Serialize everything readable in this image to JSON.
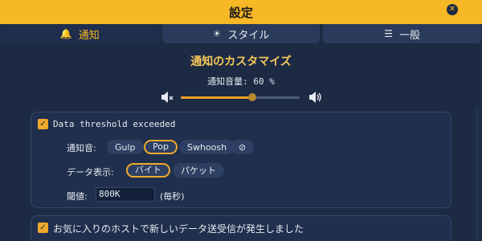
{
  "window": {
    "title": "設定",
    "close_icon": "close-icon"
  },
  "tabs": [
    {
      "label": "通知",
      "icon": "bell-icon",
      "glyph": "🔔",
      "active": true
    },
    {
      "label": "スタイル",
      "icon": "sun-icon",
      "glyph": "☀",
      "active": false
    },
    {
      "label": "一般",
      "icon": "list-icon",
      "glyph": "☰",
      "active": false
    }
  ],
  "notifications": {
    "heading": "通知のカスタマイズ",
    "volume_label": "通知音量: 60 %",
    "volume_fraction": 0.6
  },
  "threshold_card": {
    "enabled": true,
    "title": "Data threshold exceeded",
    "sound_label": "通知音:",
    "sounds": [
      {
        "label": "Gulp",
        "selected": false
      },
      {
        "label": "Pop",
        "selected": true
      },
      {
        "label": "Swhoosh",
        "selected": false
      },
      {
        "label": "⊘",
        "selected": false
      }
    ],
    "display_label": "データ表示:",
    "display_options": [
      {
        "label": "バイト",
        "selected": true
      },
      {
        "label": "パケット",
        "selected": false
      }
    ],
    "threshold_label": "閾値:",
    "threshold_value": "800K",
    "threshold_unit": "(毎秒)"
  },
  "favorite_card": {
    "enabled": true,
    "title": "お気に入りのホストで新しいデータ送受信が発生しました"
  },
  "colors": {
    "accent": "#f7b825",
    "background": "#1c2a44"
  }
}
